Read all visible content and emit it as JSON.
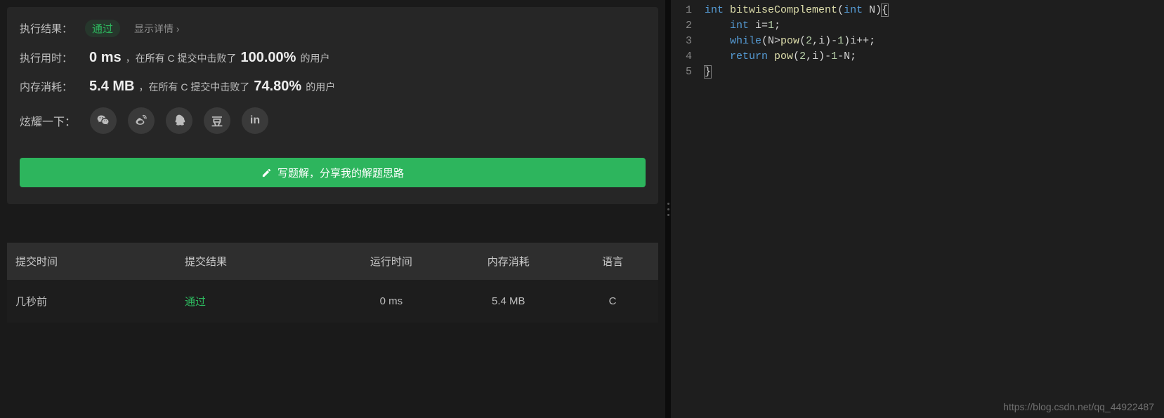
{
  "result": {
    "label": "执行结果：",
    "status": "通过",
    "detail_link": "显示详情",
    "time_label": "执行用时：",
    "time_value": "0 ms",
    "time_mid": "，在所有 C 提交中击败了",
    "time_pct": "100.00%",
    "time_suffix": "的用户",
    "mem_label": "内存消耗：",
    "mem_value": "5.4 MB",
    "mem_mid": "，在所有 C 提交中击败了",
    "mem_pct": "74.80%",
    "mem_suffix": "的用户",
    "share_label": "炫耀一下：",
    "write_btn": "写题解，分享我的解题思路"
  },
  "icons": {
    "wechat": "wechat-icon",
    "weibo": "weibo-icon",
    "qq": "qq-icon",
    "douban": "豆",
    "linkedin": "in"
  },
  "table": {
    "headers": [
      "提交时间",
      "提交结果",
      "运行时间",
      "内存消耗",
      "语言"
    ],
    "row": {
      "time": "几秒前",
      "result": "通过",
      "runtime": "0 ms",
      "memory": "5.4 MB",
      "lang": "C"
    }
  },
  "code": {
    "lines": [
      "1",
      "2",
      "3",
      "4",
      "5"
    ],
    "l1_kw1": "int",
    "l1_fn": "bitwiseComplement",
    "l1_p1": "(",
    "l1_kw2": "int",
    "l1_p2": " N)",
    "l1_br": "{",
    "l2_indent": "    ",
    "l2_kw": "int",
    "l2_rest": " i=",
    "l2_num": "1",
    "l2_semi": ";",
    "l3_indent": "    ",
    "l3_kw": "while",
    "l3_a": "(N>",
    "l3_fn": "pow",
    "l3_b": "(",
    "l3_n1": "2",
    "l3_c": ",i)-",
    "l3_n2": "1",
    "l3_d": ")i++;",
    "l4_indent": "    ",
    "l4_kw": "return",
    "l4_sp": " ",
    "l4_fn": "pow",
    "l4_a": "(",
    "l4_n1": "2",
    "l4_b": ",i)-",
    "l4_n2": "1",
    "l4_c": "-N;",
    "l5": "}"
  },
  "watermark": "https://blog.csdn.net/qq_44922487"
}
